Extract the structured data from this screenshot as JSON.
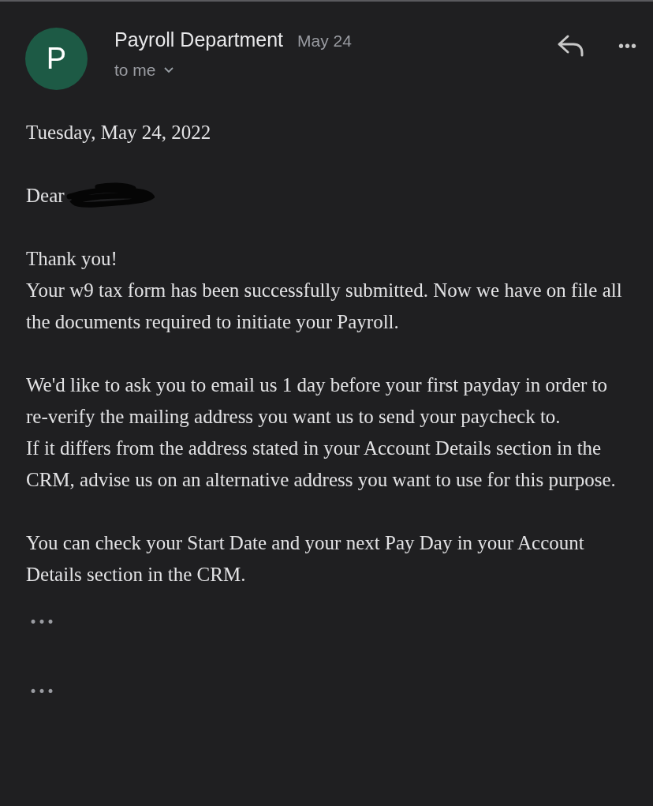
{
  "header": {
    "avatar": "P",
    "sender": "Payroll Department",
    "date": "May 24",
    "recipient": "to me",
    "more": "•••"
  },
  "body": {
    "date_line": "Tuesday, May 24, 2022",
    "greeting": "Dear",
    "greeting_redacted": true,
    "paragraphs": [
      [
        "Thank you!",
        "Your w9 tax form has been successfully submitted. Now we have on file all the documents required to initiate your Payroll."
      ],
      [
        "We'd like to ask you to email us 1 day before your first payday in order to re-verify the mailing address you want us to send your paycheck to.",
        "If it differs from the address stated in your Account Details section in the CRM, advise us on an alternative address you want to use for this purpose."
      ],
      [
        "You can check your Start Date and your next Pay Day in your Account Details section in the CRM."
      ]
    ]
  },
  "trimmed": [
    "•••",
    "•••"
  ]
}
